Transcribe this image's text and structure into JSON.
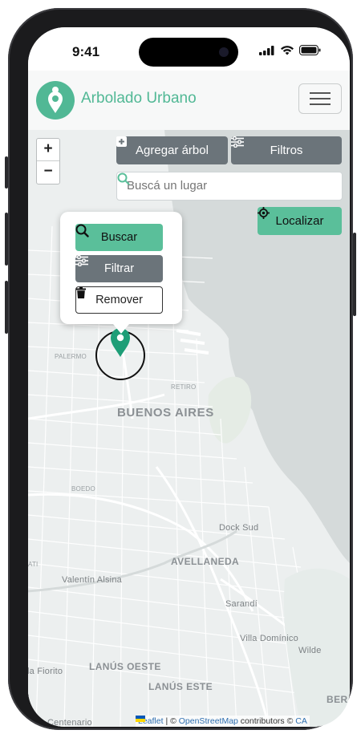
{
  "status_bar": {
    "time": "9:41"
  },
  "app": {
    "title": "Arbolado Urbano"
  },
  "toolbar": {
    "add_tree_label": "Agregar árbol",
    "filters_label": "Filtros",
    "locate_label": "Localizar",
    "search_placeholder": "Buscá un lugar"
  },
  "zoom": {
    "in_label": "+",
    "out_label": "−"
  },
  "popup": {
    "search_label": "Buscar",
    "filter_label": "Filtrar",
    "remove_label": "Remover"
  },
  "map_labels": {
    "palermo": "PALERMO",
    "retiro": "RETIRO",
    "buenos_aires": "BUENOS AIRES",
    "boedo": "BOEDO",
    "dock_sud": "Dock Sud",
    "avellaneda": "AVELLANEDA",
    "valentin_alsina": "Valentín Alsina",
    "sarandi": "Sarandí",
    "villa_dominico": "Villa Domínico",
    "wilde": "Wilde",
    "la_fiorito": "la Fiorito",
    "lanus_oeste": "LANÚS OESTE",
    "lanus_este": "LANÚS ESTE",
    "ber": "BER",
    "ati": "ATI",
    "centenario": "Centenario"
  },
  "attribution": {
    "leaflet": "Leaflet",
    "separator": " | © ",
    "osm": "OpenStreetMap",
    "contributors": " contributors © ",
    "carto": "CA"
  },
  "colors": {
    "brand_green": "#51b895",
    "button_grey": "#6b747a",
    "button_green": "#5abf9a",
    "marker_green": "#1e9e77"
  },
  "icons": {
    "logo": "tree-pin-icon",
    "menu": "hamburger-icon",
    "add": "plus-square-icon",
    "filters": "sliders-icon",
    "search": "magnifier-icon",
    "locate": "crosshair-icon",
    "remove": "trash-icon",
    "marker": "map-pin-icon"
  }
}
